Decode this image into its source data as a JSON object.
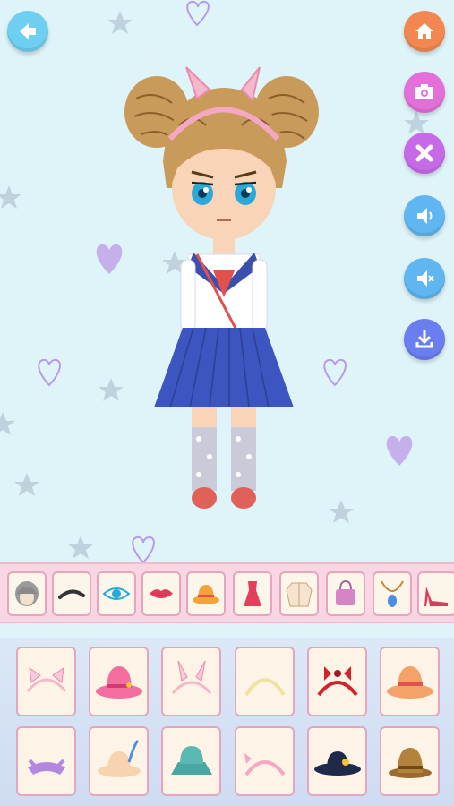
{
  "top_controls": {
    "back": {
      "icon": "back-arrow-icon",
      "color": "#6fcff0"
    },
    "home": {
      "icon": "home-icon",
      "color": "#f4874f"
    },
    "camera": {
      "icon": "camera-icon",
      "color": "#e36fd8"
    },
    "reset": {
      "icon": "close-icon",
      "color": "#c66ae8"
    },
    "sound": {
      "icon": "speaker-icon",
      "color": "#5fb6f0"
    },
    "mute": {
      "icon": "speaker-mute-icon",
      "color": "#5fb6f0"
    },
    "save": {
      "icon": "download-icon",
      "color": "#6a7ef0"
    }
  },
  "category_tabs": [
    {
      "icon": "hair-icon"
    },
    {
      "icon": "eyebrow-icon"
    },
    {
      "icon": "eye-icon"
    },
    {
      "icon": "lips-icon"
    },
    {
      "icon": "hat-icon"
    },
    {
      "icon": "dress-icon"
    },
    {
      "icon": "jacket-icon"
    },
    {
      "icon": "bag-icon"
    },
    {
      "icon": "necklace-icon"
    },
    {
      "icon": "high-heel-icon"
    }
  ],
  "items": [
    {
      "icon": "cat-ear-headband-icon"
    },
    {
      "icon": "pink-sun-hat-icon"
    },
    {
      "icon": "bunny-ear-headband-icon"
    },
    {
      "icon": "yellow-headband-icon"
    },
    {
      "icon": "red-bow-headband-icon"
    },
    {
      "icon": "orange-bucket-hat-icon"
    },
    {
      "icon": "purple-bandana-icon"
    },
    {
      "icon": "feather-fedora-icon"
    },
    {
      "icon": "teal-bucket-hat-icon"
    },
    {
      "icon": "pink-bow-headband-icon"
    },
    {
      "icon": "navy-flower-hat-icon"
    },
    {
      "icon": "brown-cap-icon"
    }
  ]
}
